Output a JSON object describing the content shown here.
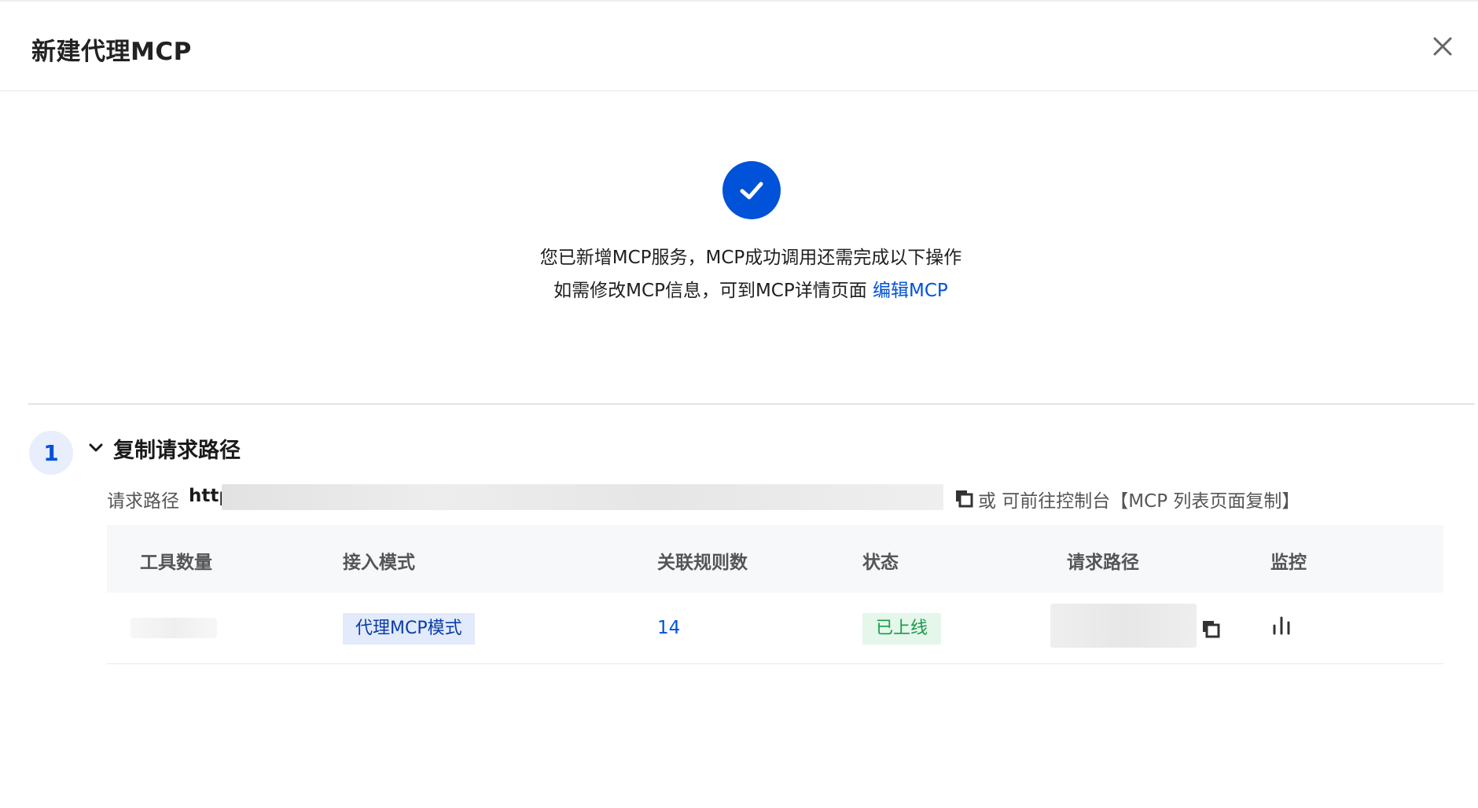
{
  "dialog": {
    "title": "新建代理MCP"
  },
  "success": {
    "line1": "您已新增MCP服务，MCP成功调用还需完成以下操作",
    "line2_prefix": "如需修改MCP信息，可到MCP详情页面 ",
    "edit_link": "编辑MCP"
  },
  "step": {
    "number": "1",
    "title": "复制请求路径",
    "path_label": "请求路径",
    "path_prefix": "http",
    "path_hint": "或 可前往控制台【MCP 列表页面复制】"
  },
  "table": {
    "headers": [
      "工具数量",
      "接入模式",
      "关联规则数",
      "状态",
      "请求路径",
      "监控"
    ],
    "row": {
      "mode": "代理MCP模式",
      "rule_count": "14",
      "status": "已上线"
    }
  },
  "colors": {
    "primary": "#0052d9",
    "success_bg": "#e5f6ea",
    "success_text": "#179b4a",
    "mode_bg": "#e2eafc"
  }
}
